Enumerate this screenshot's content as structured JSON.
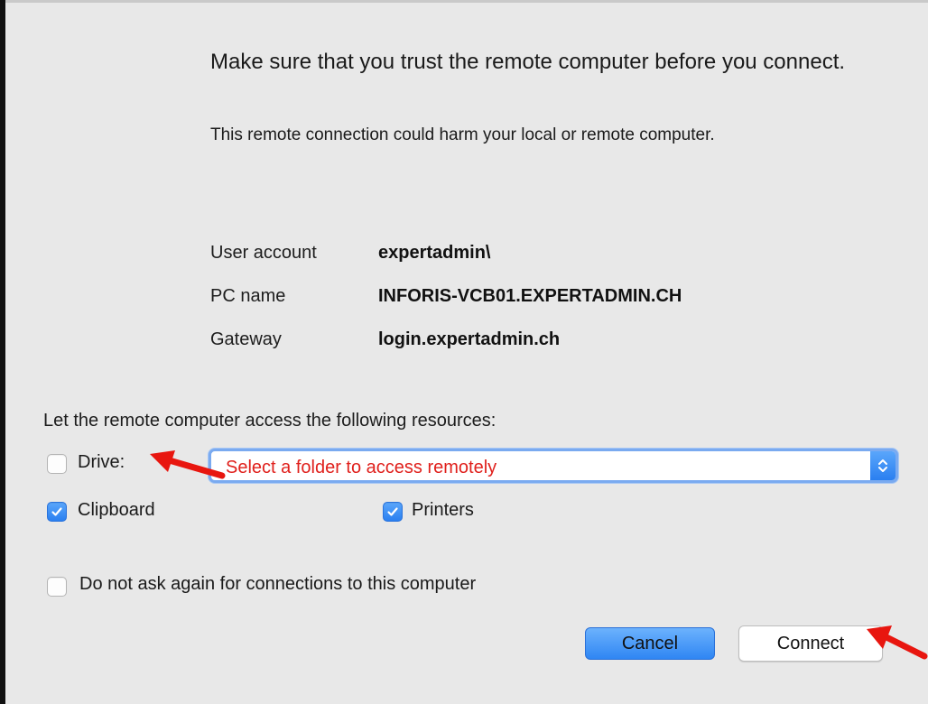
{
  "dialog": {
    "heading": "Make sure that you trust the remote computer before you connect.",
    "subtext": "This remote connection could harm your local or remote computer."
  },
  "info": [
    {
      "label": "User account",
      "value": "expertadmin\\"
    },
    {
      "label": "PC name",
      "value": "INFORIS-VCB01.EXPERTADMIN.CH"
    },
    {
      "label": "Gateway",
      "value": "login.expertadmin.ch"
    }
  ],
  "resources": {
    "label": "Let the remote computer access the following resources:",
    "drive": {
      "label": "Drive:",
      "checked": false
    },
    "folder_select": {
      "value": "Select a folder to access remotely"
    },
    "clipboard": {
      "label": "Clipboard",
      "checked": true
    },
    "printers": {
      "label": "Printers",
      "checked": true
    }
  },
  "do_not_ask": {
    "label": "Do not ask again for connections to this computer",
    "checked": false
  },
  "buttons": {
    "cancel": "Cancel",
    "connect": "Connect"
  },
  "colors": {
    "accent": "#2a7ff0",
    "annotation_arrow": "#e8160f",
    "select_text": "#e0201c"
  },
  "icons": {
    "checkmark": "checkmark-icon",
    "stepper": "up-down-chevron-icon",
    "annotation": "red-arrow-icon"
  }
}
